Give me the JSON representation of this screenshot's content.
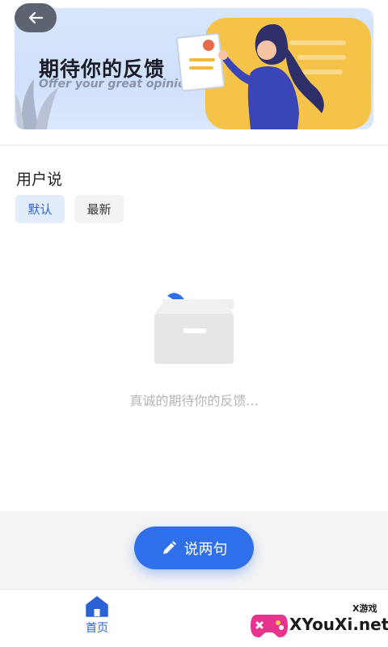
{
  "banner": {
    "title": "期待你的反馈",
    "subtitle": "Offer your great opinion"
  },
  "back_icon": "arrow-left-icon",
  "section_title": "用户说",
  "filters": [
    {
      "label": "默认",
      "selected": true
    },
    {
      "label": "最新",
      "selected": false
    }
  ],
  "empty_state": {
    "text": "真诚的期待你的反馈..."
  },
  "action_button": {
    "label": "说两句",
    "icon": "pencil-icon"
  },
  "tabbar": {
    "home_label": "首页",
    "home_icon": "home-icon"
  },
  "watermark": {
    "small": "X游戏",
    "big": "XYouXi.net"
  },
  "colors": {
    "accent": "#2f6fea",
    "tab_active_bg": "#e3ecfb",
    "banner_bg": "#d7e6fb"
  }
}
